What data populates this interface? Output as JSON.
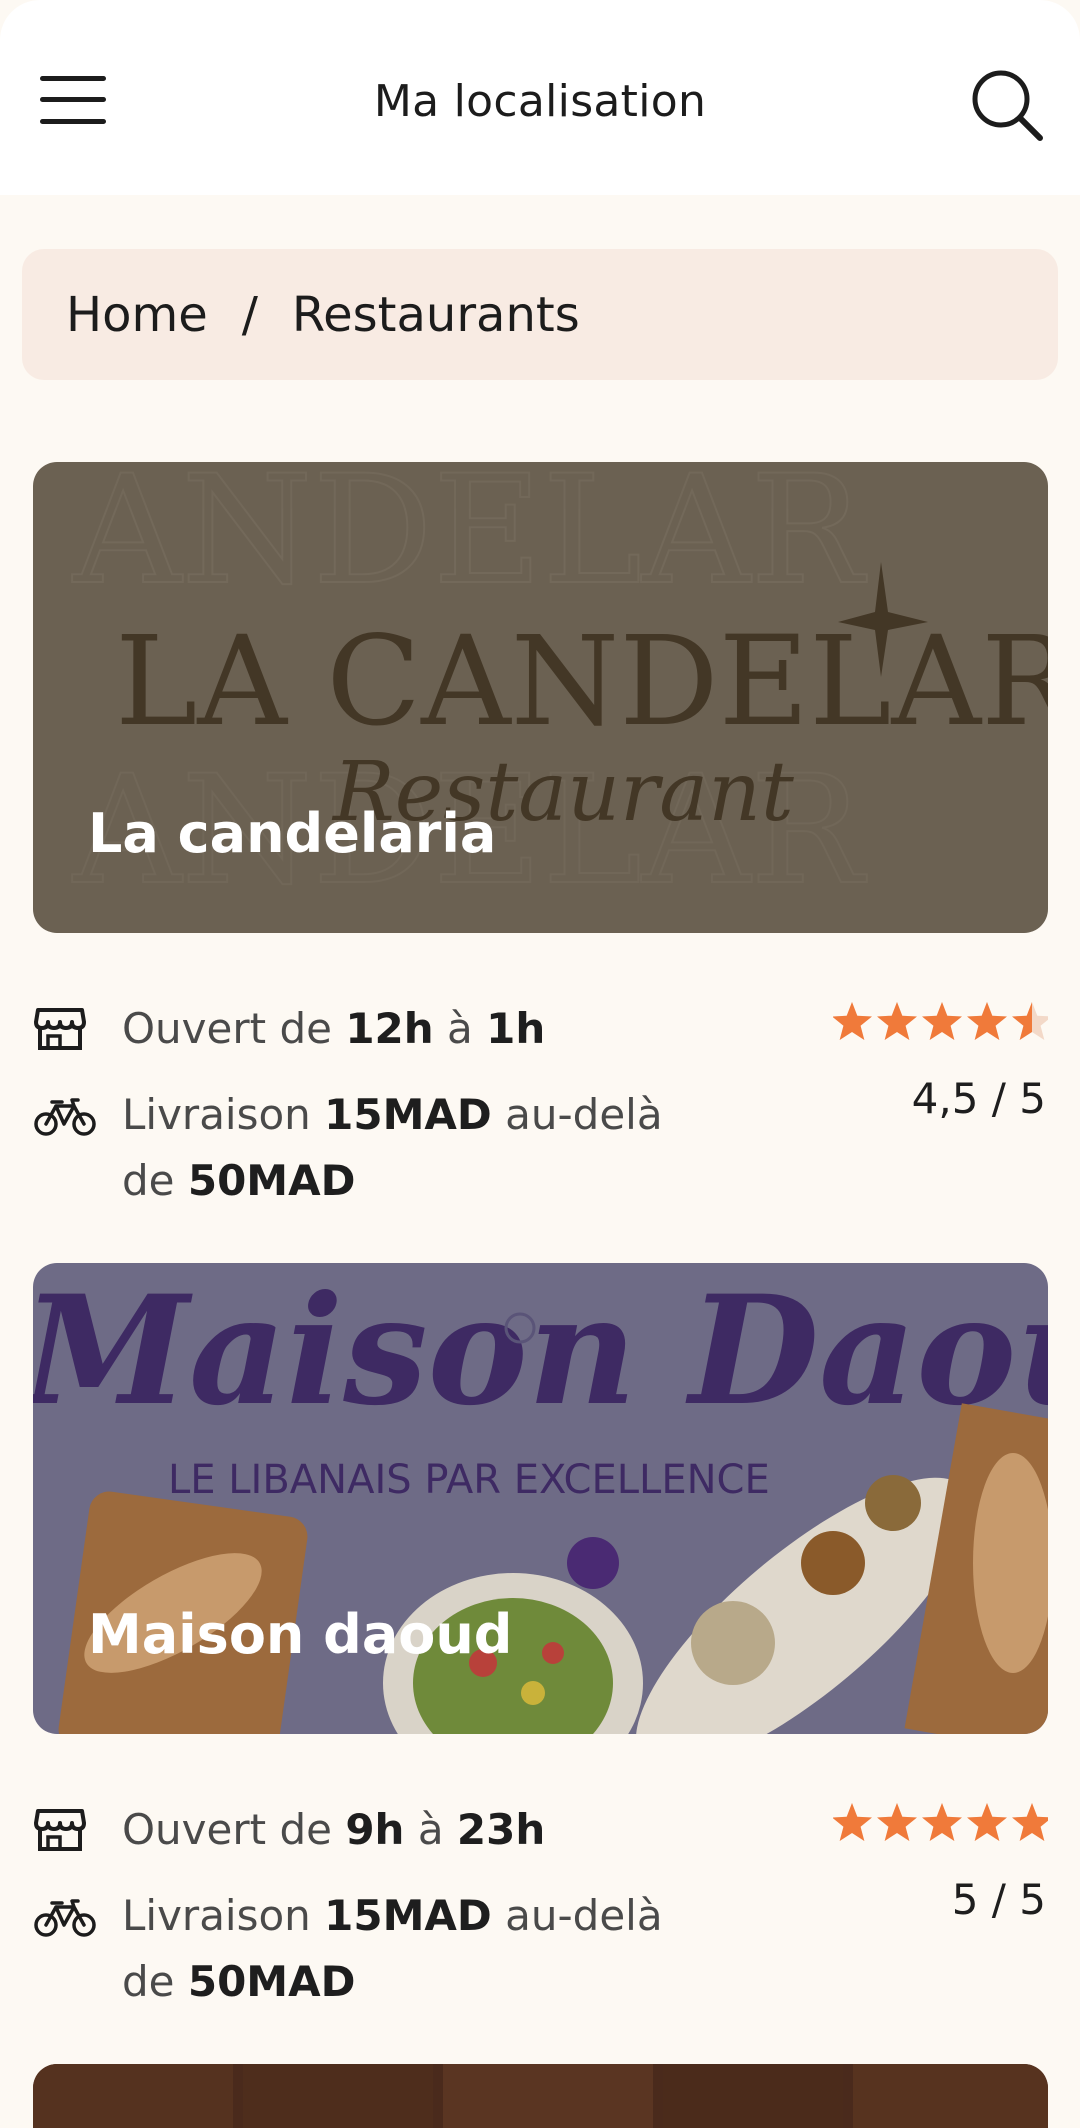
{
  "header": {
    "title": "Ma localisation"
  },
  "breadcrumb": {
    "home": "Home",
    "separator": "/",
    "current": "Restaurants"
  },
  "restaurants": [
    {
      "name": "La candelaria",
      "logo_text": "LA CANDELARIA",
      "logo_subtext": "Restaurant",
      "hours_prefix": "Ouvert de",
      "open": "12h",
      "hours_mid": "à",
      "close": "1h",
      "delivery_prefix": "Livraison",
      "delivery_fee": "15MAD",
      "delivery_mid": "au-delà",
      "delivery_de": "de",
      "delivery_min": "50MAD",
      "rating": 4.5,
      "rating_text": "4,5 / 5"
    },
    {
      "name": "Maison daoud",
      "logo_text": "Maison Daoud",
      "logo_subtext": "LE LIBANAIS PAR EXCELLENCE",
      "hours_prefix": "Ouvert de",
      "open": "9h",
      "hours_mid": "à",
      "close": "23h",
      "delivery_prefix": "Livraison",
      "delivery_fee": "15MAD",
      "delivery_mid": "au-delà",
      "delivery_de": "de",
      "delivery_min": "50MAD",
      "rating": 5,
      "rating_text": "5 / 5"
    }
  ],
  "colors": {
    "star": "#f07a3a",
    "star_empty": "#f3d9c8",
    "card_overlay": "#5c5346",
    "breadcrumb_bg": "#f8ebe3"
  }
}
